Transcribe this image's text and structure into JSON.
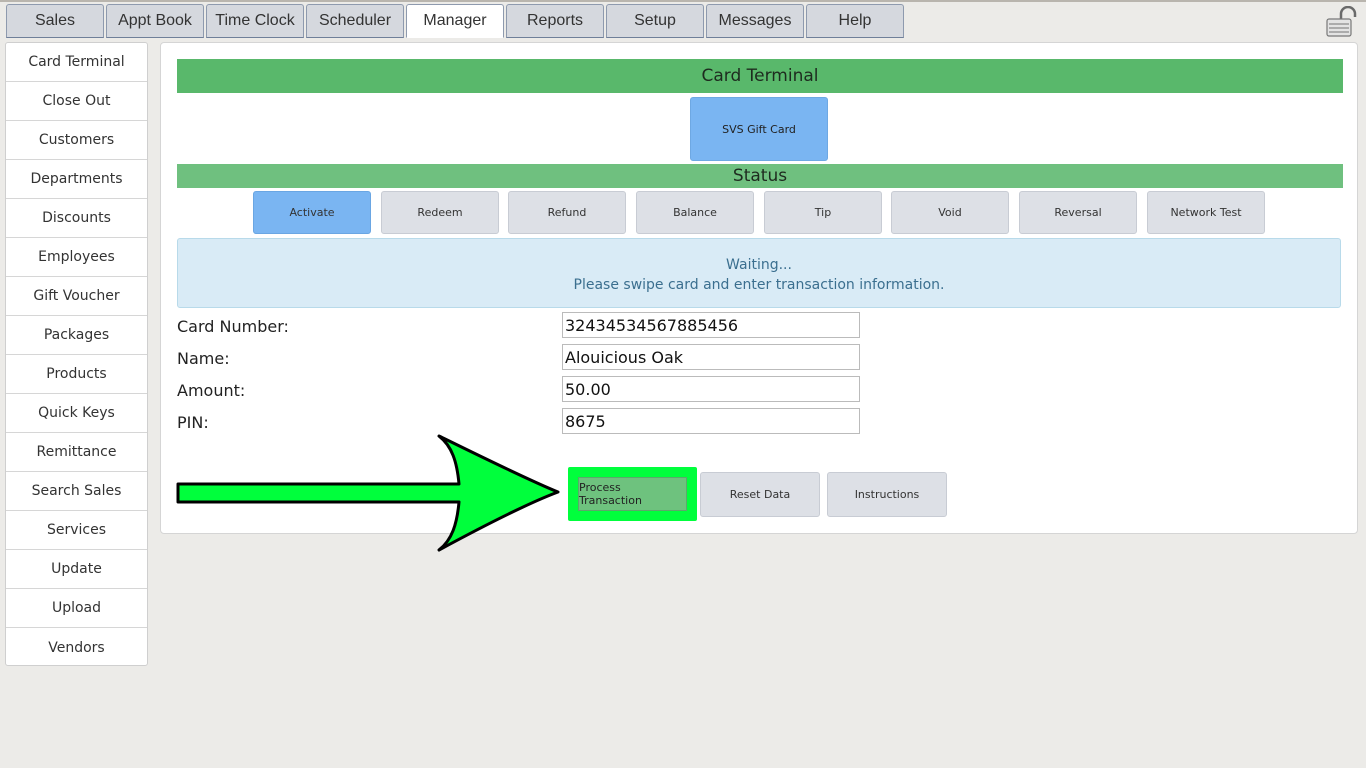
{
  "nav": {
    "tabs": [
      {
        "label": "Sales"
      },
      {
        "label": "Appt Book"
      },
      {
        "label": "Time Clock"
      },
      {
        "label": "Scheduler"
      },
      {
        "label": "Manager"
      },
      {
        "label": "Reports"
      },
      {
        "label": "Setup"
      },
      {
        "label": "Messages"
      },
      {
        "label": "Help"
      }
    ],
    "active_tab": "Manager",
    "lock_icon": "lock-icon"
  },
  "sidebar": {
    "items": [
      {
        "label": "Card Terminal"
      },
      {
        "label": "Close Out"
      },
      {
        "label": "Customers"
      },
      {
        "label": "Departments"
      },
      {
        "label": "Discounts"
      },
      {
        "label": "Employees"
      },
      {
        "label": "Gift Voucher"
      },
      {
        "label": "Packages"
      },
      {
        "label": "Products"
      },
      {
        "label": "Quick Keys"
      },
      {
        "label": "Remittance"
      },
      {
        "label": "Search Sales"
      },
      {
        "label": "Services"
      },
      {
        "label": "Update"
      },
      {
        "label": "Upload"
      },
      {
        "label": "Vendors"
      }
    ]
  },
  "main": {
    "title": "Card Terminal",
    "card_type_button": "SVS Gift Card",
    "status_title": "Status",
    "actions": [
      {
        "label": "Activate"
      },
      {
        "label": "Redeem"
      },
      {
        "label": "Refund"
      },
      {
        "label": "Balance"
      },
      {
        "label": "Tip"
      },
      {
        "label": "Void"
      },
      {
        "label": "Reversal"
      },
      {
        "label": "Network Test"
      }
    ],
    "active_action": "Activate",
    "status_message": {
      "line1": "Waiting...",
      "line2": "Please swipe card and enter transaction information."
    },
    "fields": {
      "card_number": {
        "label": "Card Number:",
        "value": "32434534567885456"
      },
      "name": {
        "label": "Name:",
        "value": "Alouicious Oak"
      },
      "amount": {
        "label": "Amount:",
        "value": "50.00"
      },
      "pin": {
        "label": "PIN:",
        "value": "8675"
      }
    },
    "buttons": {
      "process": "Process Transaction",
      "reset": "Reset Data",
      "instructions": "Instructions"
    }
  },
  "colors": {
    "header_green": "#59b86b",
    "status_green": "#6fc07f",
    "active_blue": "#7ab5f2",
    "highlight_green": "#00ff3c",
    "status_box": "#d9ebf6"
  }
}
